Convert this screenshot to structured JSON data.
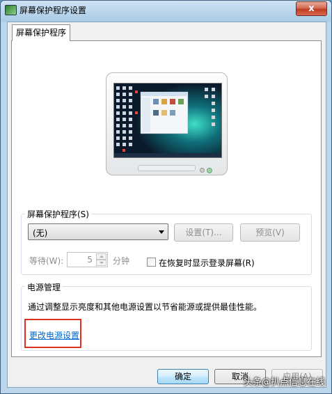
{
  "window": {
    "title": "屏幕保护程序设置",
    "close_glyph": "x"
  },
  "tab": {
    "label": "屏幕保护程序"
  },
  "screensaver": {
    "group_label": "屏幕保护程序(S)",
    "selected": "(无)",
    "settings_button": "设置(T)...",
    "preview_button": "预览(V)",
    "wait_label": "等待(W):",
    "wait_value": "5",
    "minutes_label": "分钟",
    "resume_checkbox_label": "在恢复时显示登录屏幕(R)",
    "resume_checked": false
  },
  "power": {
    "group_label": "电源管理",
    "description": "通过调整显示亮度和其他电源设置以节省能源或提供最佳性能。",
    "link": "更改电源设置",
    "highlight_color": "#e0301e"
  },
  "footer": {
    "ok_button": "确定",
    "cancel_button": "取消",
    "apply_button": "应用(A)"
  },
  "watermark": {
    "text": "头条@扒点信息在线"
  },
  "colors": {
    "accent": "#3c7fb1",
    "link": "#0066cc"
  }
}
